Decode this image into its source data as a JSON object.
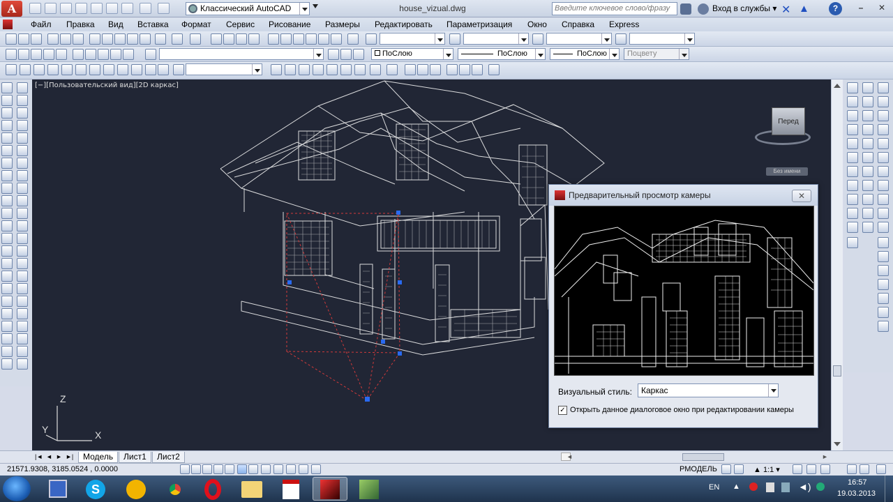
{
  "titlebar": {
    "app_logo": "A",
    "workspace": "Классический AutoCAD",
    "document_title": "house_vizual.dwg",
    "search_placeholder": "Введите ключевое слово/фразу",
    "login": "Вход в службы",
    "help": "?"
  },
  "menu": [
    "Файл",
    "Правка",
    "Вид",
    "Вставка",
    "Формат",
    "Сервис",
    "Рисование",
    "Размеры",
    "Редактировать",
    "Параметризация",
    "Окно",
    "Справка",
    "Express"
  ],
  "properties_toolbar": {
    "color": "ПоСлою",
    "linetype": "ПоСлою",
    "lineweight": "ПоСлою",
    "plotstyle": "Поцвету"
  },
  "viewport": {
    "label": "[−][Пользовательский вид][2D каркас]",
    "viewcube_face": "Перед",
    "viewcube_ucs": "Без имени",
    "axis_x": "X",
    "axis_y": "Y",
    "axis_z": "Z"
  },
  "tabs": [
    "Модель",
    "Лист1",
    "Лист2"
  ],
  "status": {
    "coordinates": "21571.9308, 3185.0524 , 0.0000",
    "model_label": "РМОДЕЛЬ",
    "scale": "1:1"
  },
  "camera_dialog": {
    "title": "Предварительный просмотр камеры",
    "close": "✕",
    "style_label": "Визуальный стиль:",
    "style_value": "Каркас",
    "checkbox_checked": true,
    "checkbox_mark": "✓",
    "checkbox_label": "Открыть данное диалоговое окно при редактировании камеры"
  },
  "taskbar": {
    "language": "EN",
    "time": "16:57",
    "date": "19.03.2013"
  }
}
